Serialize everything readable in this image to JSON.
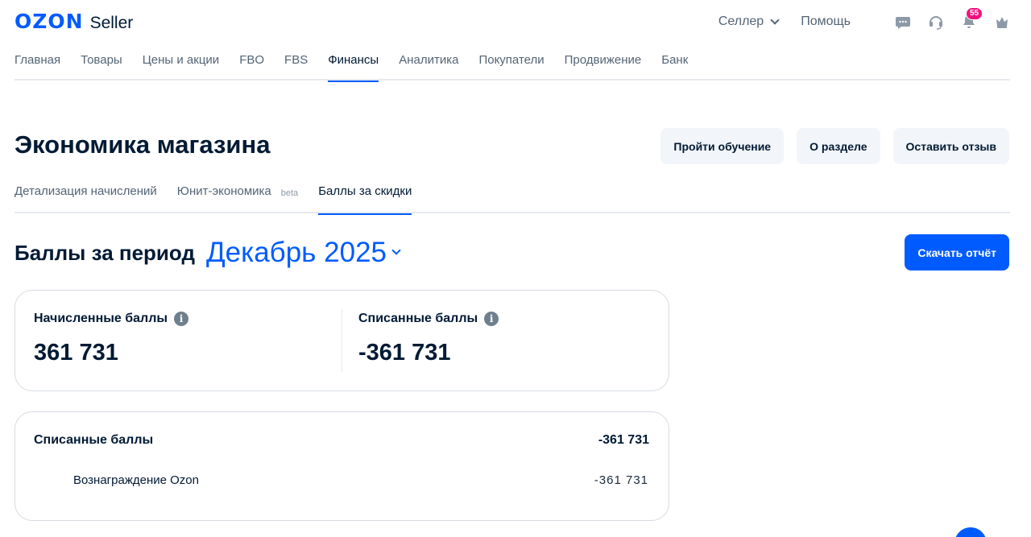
{
  "header": {
    "logo_ozon": "OZON",
    "logo_seller": "Seller",
    "seller_menu": "Селлер",
    "help": "Помощь",
    "notifications_count": "55",
    "accent_color": "#005bff"
  },
  "nav": {
    "items": [
      {
        "label": "Главная"
      },
      {
        "label": "Товары"
      },
      {
        "label": "Цены и акции"
      },
      {
        "label": "FBO"
      },
      {
        "label": "FBS"
      },
      {
        "label": "Финансы"
      },
      {
        "label": "Аналитика"
      },
      {
        "label": "Покупатели"
      },
      {
        "label": "Продвижение"
      },
      {
        "label": "Банк"
      }
    ],
    "active": "Финансы"
  },
  "page": {
    "title": "Экономика магазина",
    "actions": {
      "learn": "Пройти обучение",
      "about": "О разделе",
      "feedback": "Оставить отзыв"
    }
  },
  "subtabs": {
    "items": [
      {
        "label": "Детализация начислений"
      },
      {
        "label": "Юнит-экономика",
        "badge": "beta"
      },
      {
        "label": "Баллы за скидки"
      }
    ],
    "active": "Баллы за скидки"
  },
  "period": {
    "label": "Баллы за период",
    "value": "Декабрь 2025",
    "download": "Скачать отчёт"
  },
  "summary": {
    "accrued_label": "Начисленные баллы",
    "accrued_value": "361 731",
    "debited_label": "Списанные баллы",
    "debited_value": "-361 731"
  },
  "breakdown": {
    "title": "Списанные баллы",
    "total": "-361 731",
    "rows": [
      {
        "label": "Вознаграждение Ozon",
        "value": "-361 731"
      }
    ]
  }
}
